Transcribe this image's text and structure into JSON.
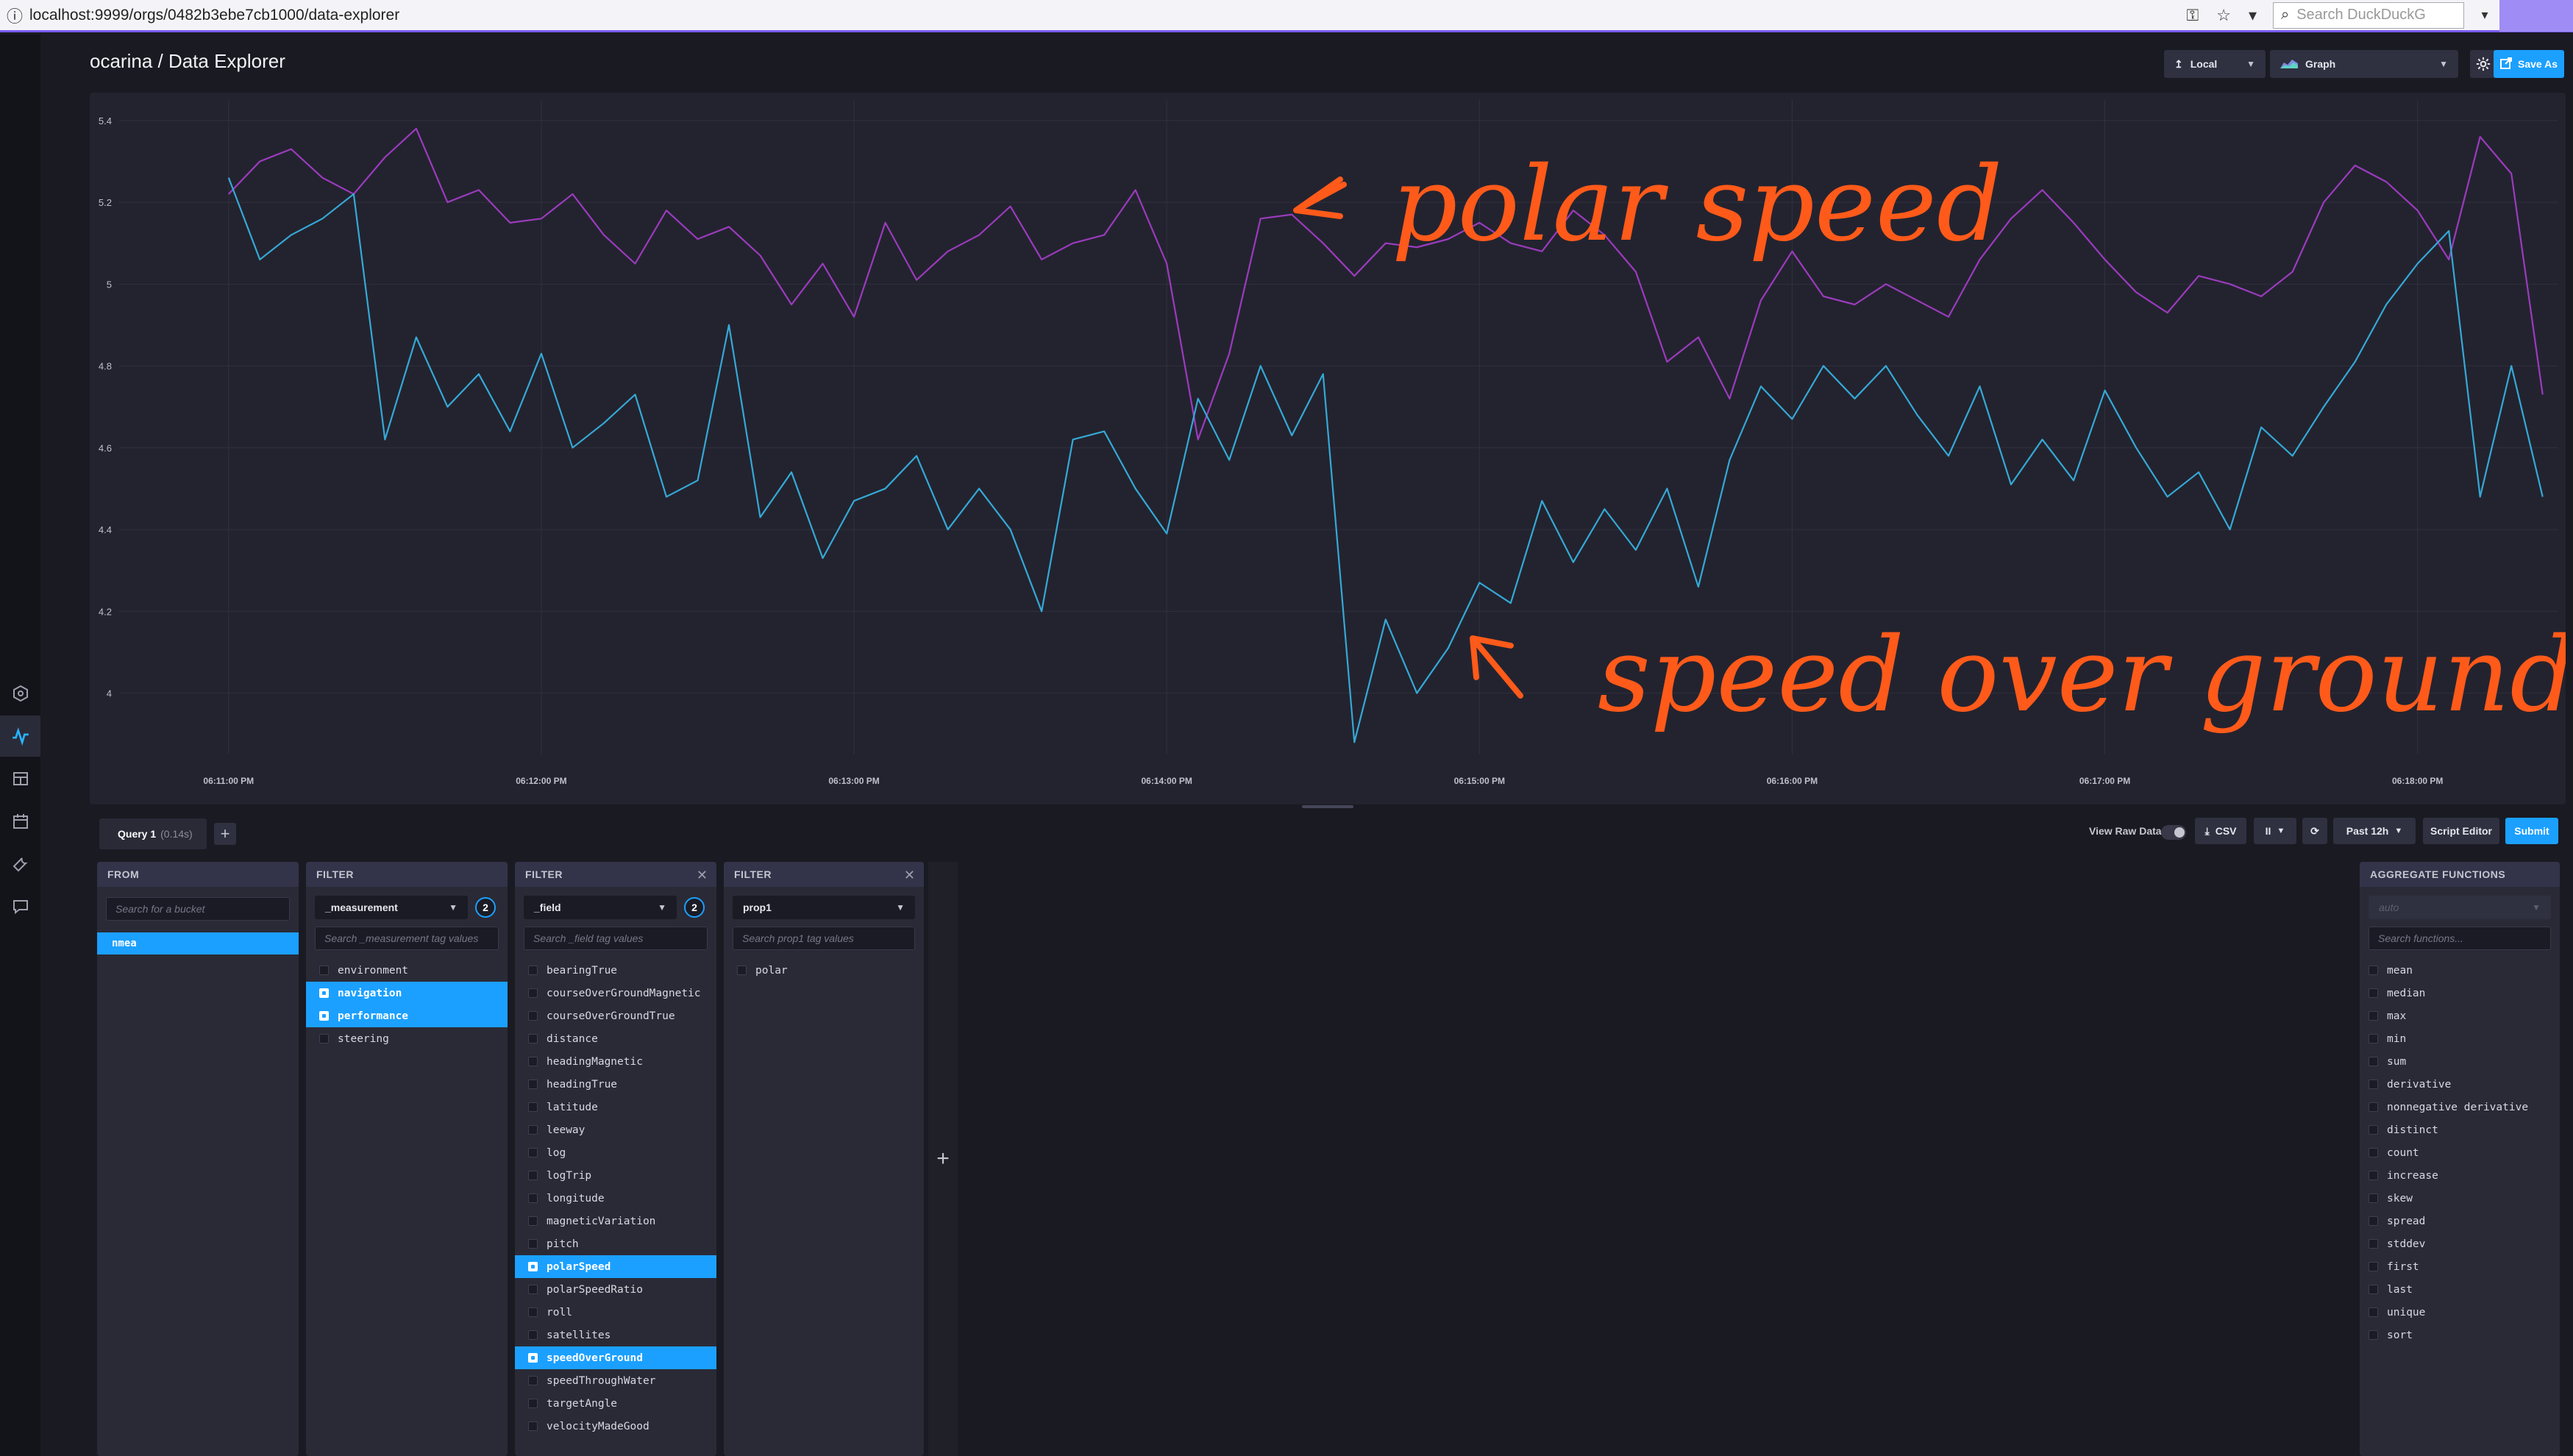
{
  "browser": {
    "url": "localhost:9999/orgs/0482b3ebe7cb1000/data-explorer",
    "search_placeholder": "Search DuckDuckG"
  },
  "header": {
    "title": "ocarina / Data Explorer",
    "timezone": "Local",
    "view_type": "Graph",
    "save_as": "Save As"
  },
  "chart_data": {
    "type": "line",
    "title": "",
    "xlabel": "",
    "ylabel": "",
    "ylim": [
      3.85,
      5.45
    ],
    "yticks": [
      "5.4",
      "5.2",
      "5",
      "4.8",
      "4.6",
      "4.4",
      "4.2",
      "4"
    ],
    "xticks": [
      "06:11:00 PM",
      "06:12:00 PM",
      "06:13:00 PM",
      "06:14:00 PM",
      "06:15:00 PM",
      "06:16:00 PM",
      "06:17:00 PM",
      "06:18:00 PM"
    ],
    "grid": true,
    "series": [
      {
        "color": "#9b3bbd",
        "x_minutes": [
          0,
          0.1,
          0.2,
          0.3,
          0.4,
          0.5,
          0.6,
          0.7,
          0.8,
          0.9,
          1.0,
          1.1,
          1.2,
          1.3,
          1.4,
          1.5,
          1.6,
          1.7,
          1.8,
          1.9,
          2.0,
          2.1,
          2.2,
          2.3,
          2.4,
          2.5,
          2.6,
          2.7,
          2.8,
          2.9,
          3.0,
          3.1,
          3.2,
          3.3,
          3.4,
          3.5,
          3.6,
          3.7,
          3.8,
          3.9,
          4.0,
          4.1,
          4.2,
          4.3,
          4.4,
          4.5,
          4.6,
          4.7,
          4.8,
          4.9,
          5.0,
          5.1,
          5.2,
          5.3,
          5.4,
          5.5,
          5.6,
          5.7,
          5.8,
          5.9,
          6.0,
          6.1,
          6.2,
          6.3,
          6.4,
          6.5,
          6.6,
          6.7,
          6.8,
          6.9,
          7.0,
          7.1,
          7.2,
          7.3,
          7.4
        ],
        "values": [
          5.22,
          5.3,
          5.33,
          5.26,
          5.22,
          5.31,
          5.38,
          5.2,
          5.23,
          5.15,
          5.16,
          5.22,
          5.12,
          5.05,
          5.18,
          5.11,
          5.14,
          5.07,
          4.95,
          5.05,
          4.92,
          5.15,
          5.01,
          5.08,
          5.12,
          5.19,
          5.06,
          5.1,
          5.12,
          5.23,
          5.05,
          4.62,
          4.83,
          5.16,
          5.17,
          5.1,
          5.02,
          5.1,
          5.09,
          5.11,
          5.15,
          5.1,
          5.08,
          5.18,
          5.12,
          5.03,
          4.81,
          4.87,
          4.72,
          4.96,
          5.08,
          4.97,
          4.95,
          5.0,
          4.96,
          4.92,
          5.06,
          5.16,
          5.23,
          5.15,
          5.06,
          4.98,
          4.93,
          5.02,
          5.0,
          4.97,
          5.03,
          5.2,
          5.29,
          5.25,
          5.18,
          5.06,
          5.36,
          5.27,
          4.73
        ]
      },
      {
        "color": "#35a9d6",
        "x_minutes": [
          0,
          0.1,
          0.2,
          0.3,
          0.4,
          0.5,
          0.6,
          0.7,
          0.8,
          0.9,
          1.0,
          1.1,
          1.2,
          1.3,
          1.4,
          1.5,
          1.6,
          1.7,
          1.8,
          1.9,
          2.0,
          2.1,
          2.2,
          2.3,
          2.4,
          2.5,
          2.6,
          2.7,
          2.8,
          2.9,
          3.0,
          3.1,
          3.2,
          3.3,
          3.4,
          3.5,
          3.6,
          3.7,
          3.8,
          3.9,
          4.0,
          4.1,
          4.2,
          4.3,
          4.4,
          4.5,
          4.6,
          4.7,
          4.8,
          4.9,
          5.0,
          5.1,
          5.2,
          5.3,
          5.4,
          5.5,
          5.6,
          5.7,
          5.8,
          5.9,
          6.0,
          6.1,
          6.2,
          6.3,
          6.4,
          6.5,
          6.6,
          6.7,
          6.8,
          6.9,
          7.0,
          7.1,
          7.2,
          7.3,
          7.4
        ],
        "values": [
          5.26,
          5.06,
          5.12,
          5.16,
          5.22,
          4.62,
          4.87,
          4.7,
          4.78,
          4.64,
          4.83,
          4.6,
          4.66,
          4.73,
          4.48,
          4.52,
          4.9,
          4.43,
          4.54,
          4.33,
          4.47,
          4.5,
          4.58,
          4.4,
          4.5,
          4.4,
          4.2,
          4.62,
          4.64,
          4.5,
          4.39,
          4.72,
          4.57,
          4.8,
          4.63,
          4.78,
          3.88,
          4.18,
          4.0,
          4.11,
          4.27,
          4.22,
          4.47,
          4.32,
          4.45,
          4.35,
          4.5,
          4.26,
          4.57,
          4.75,
          4.67,
          4.8,
          4.72,
          4.8,
          4.68,
          4.58,
          4.75,
          4.51,
          4.62,
          4.52,
          4.74,
          4.6,
          4.48,
          4.54,
          4.4,
          4.65,
          4.58,
          4.7,
          4.81,
          4.95,
          5.05,
          5.13,
          4.48,
          4.8,
          4.48
        ]
      }
    ],
    "annotations": [
      "polar speed",
      "speed over ground"
    ]
  },
  "query": {
    "tab_label": "Query 1",
    "tab_time": "(0.14s)",
    "view_raw": "View Raw Data",
    "csv": "CSV",
    "pause_icon": "II",
    "time_range": "Past 12h",
    "script_editor": "Script Editor",
    "submit": "Submit"
  },
  "from_panel": {
    "title": "FROM",
    "search_placeholder": "Search for a bucket",
    "bucket": "nmea"
  },
  "filter1": {
    "title": "FILTER",
    "key": "_measurement",
    "count": "2",
    "search_placeholder": "Search _measurement tag values",
    "items": [
      {
        "label": "environment",
        "selected": false
      },
      {
        "label": "navigation",
        "selected": true
      },
      {
        "label": "performance",
        "selected": true
      },
      {
        "label": "steering",
        "selected": false
      }
    ]
  },
  "filter2": {
    "title": "FILTER",
    "key": "_field",
    "count": "2",
    "search_placeholder": "Search _field tag values",
    "items": [
      {
        "label": "bearingTrue",
        "selected": false
      },
      {
        "label": "courseOverGroundMagnetic",
        "selected": false
      },
      {
        "label": "courseOverGroundTrue",
        "selected": false
      },
      {
        "label": "distance",
        "selected": false
      },
      {
        "label": "headingMagnetic",
        "selected": false
      },
      {
        "label": "headingTrue",
        "selected": false
      },
      {
        "label": "latitude",
        "selected": false
      },
      {
        "label": "leeway",
        "selected": false
      },
      {
        "label": "log",
        "selected": false
      },
      {
        "label": "logTrip",
        "selected": false
      },
      {
        "label": "longitude",
        "selected": false
      },
      {
        "label": "magneticVariation",
        "selected": false
      },
      {
        "label": "pitch",
        "selected": false
      },
      {
        "label": "polarSpeed",
        "selected": true
      },
      {
        "label": "polarSpeedRatio",
        "selected": false
      },
      {
        "label": "roll",
        "selected": false
      },
      {
        "label": "satellites",
        "selected": false
      },
      {
        "label": "speedOverGround",
        "selected": true
      },
      {
        "label": "speedThroughWater",
        "selected": false
      },
      {
        "label": "targetAngle",
        "selected": false
      },
      {
        "label": "velocityMadeGood",
        "selected": false
      }
    ]
  },
  "filter3": {
    "title": "FILTER",
    "key": "prop1",
    "search_placeholder": "Search prop1 tag values",
    "items": [
      {
        "label": "polar",
        "selected": false
      }
    ]
  },
  "aggregate": {
    "title": "AGGREGATE FUNCTIONS",
    "window": "auto",
    "search_placeholder": "Search functions...",
    "items": [
      "mean",
      "median",
      "max",
      "min",
      "sum",
      "derivative",
      "nonnegative derivative",
      "distinct",
      "count",
      "increase",
      "skew",
      "spread",
      "stddev",
      "first",
      "last",
      "unique",
      "sort"
    ]
  },
  "add_filter_symbol": "+"
}
